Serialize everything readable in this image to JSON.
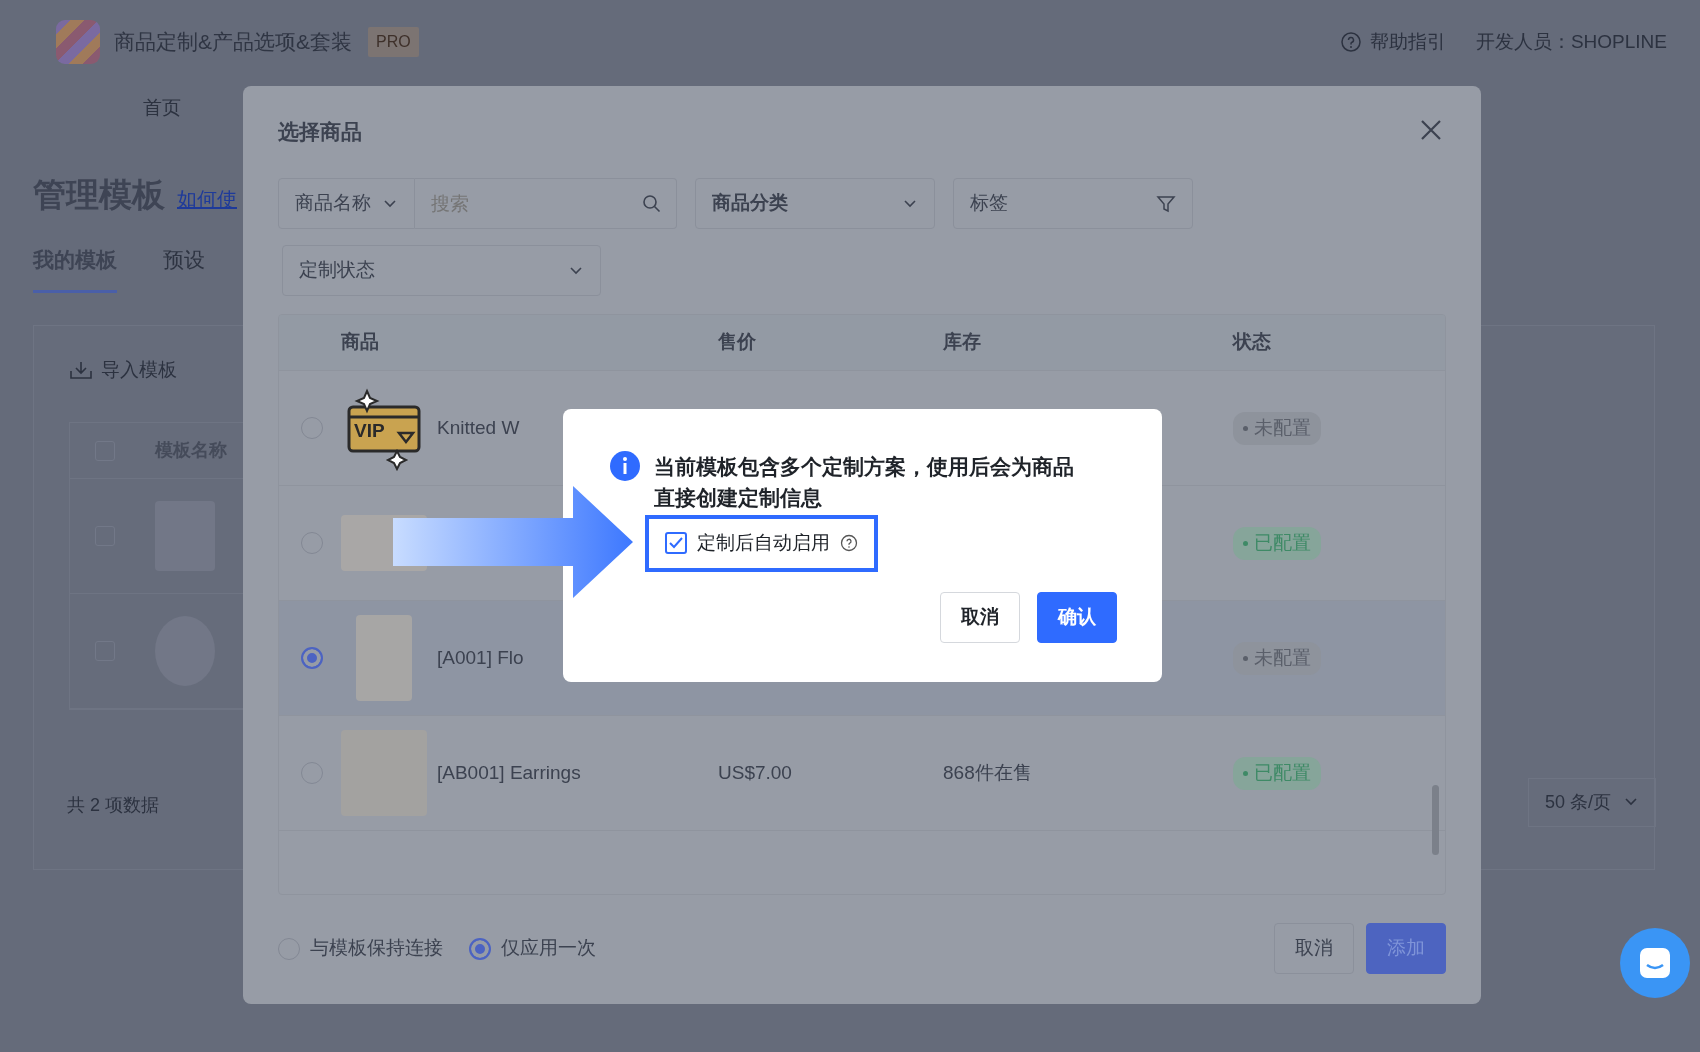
{
  "app": {
    "title": "商品定制&产品选项&套装",
    "badge": "PRO",
    "help": "帮助指引",
    "developer": "开发人员：SHOPLINE"
  },
  "page": {
    "nav": [
      "首页"
    ],
    "heading": "管理模板",
    "help_link": "如何使",
    "tabs": [
      {
        "label": "我的模板",
        "selected": true
      },
      {
        "label": "预设",
        "selected": false
      }
    ],
    "toolbar": [
      "导入模板"
    ],
    "table": {
      "select_all": {
        "checked": false
      },
      "columns": [
        "模板名称"
      ],
      "rows": [
        {
          "checked": false,
          "kind": "photo"
        },
        {
          "checked": false,
          "kind": "sticker"
        }
      ]
    },
    "total": "共 2 项数据",
    "page_size": "50 条/页"
  },
  "modal": {
    "title": "选择商品",
    "field_type": "商品名称",
    "search": {
      "placeholder": "搜索"
    },
    "category": "商品分类",
    "tags": "标签",
    "status_filter": "定制状态",
    "columns": [
      "商品",
      "售价",
      "库存",
      "状态"
    ],
    "rows": [
      {
        "kind": "icon",
        "icon_text": "VIP",
        "name": "Knitted W",
        "status": "未配置",
        "configured": false,
        "selected": false
      },
      {
        "kind": "photo",
        "status": "已配置",
        "configured": true,
        "selected": false
      },
      {
        "kind": "shirt",
        "name": "[A001] Flo",
        "status": "未配置",
        "configured": false,
        "selected": true
      },
      {
        "kind": "earrings",
        "name": "[AB001] Earrings",
        "price": "US$7.00",
        "stock": "868件在售",
        "status": "已配置",
        "configured": true,
        "selected": false
      }
    ],
    "link_modes": [
      {
        "label": "与模板保持连接",
        "selected": false
      },
      {
        "label": "仅应用一次",
        "selected": true
      }
    ],
    "buttons": [
      {
        "label": "取消",
        "kind": "secondary"
      },
      {
        "label": "添加",
        "kind": "primary"
      }
    ]
  },
  "confirm": {
    "message": "当前模板包含多个定制方案，使用后会为商品直接创建定制信息",
    "auto_enable": {
      "label": "定制后自动启用",
      "checked": true
    },
    "buttons": [
      {
        "label": "取消",
        "kind": "secondary"
      },
      {
        "label": "确认",
        "kind": "primary"
      }
    ]
  }
}
